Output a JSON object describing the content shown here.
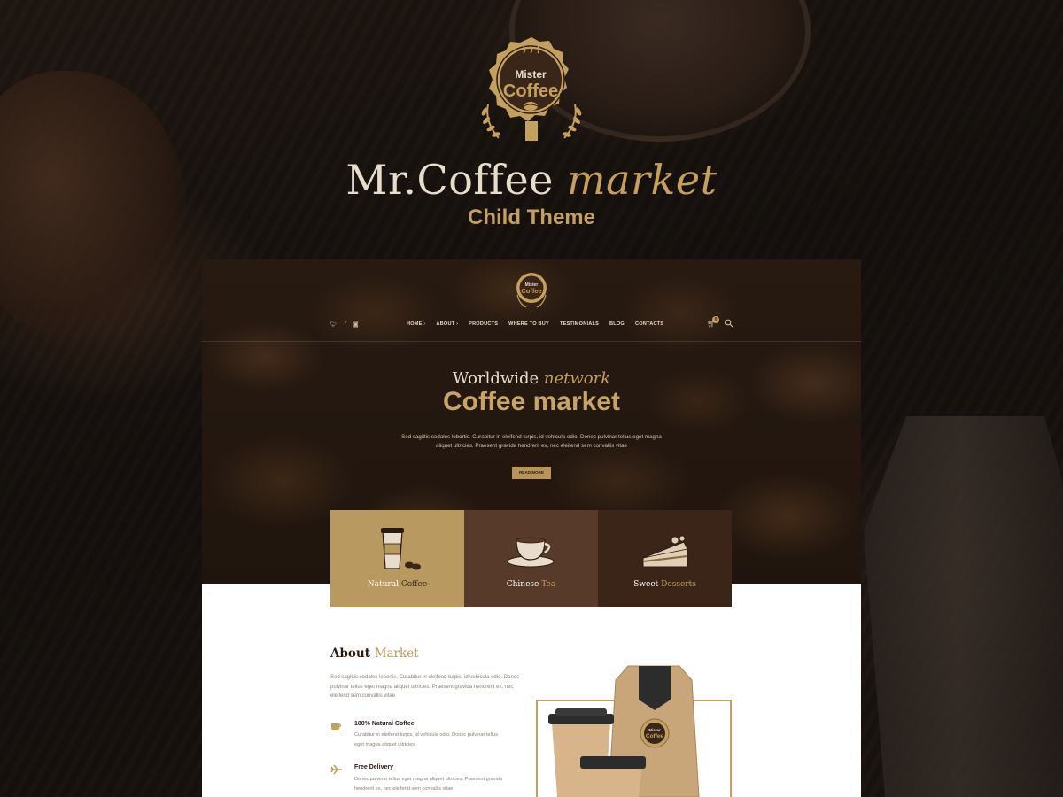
{
  "branding": {
    "logo_top": "Mister",
    "logo_main": "Coffee",
    "title_main": "Mr.Coffee",
    "title_accent": "market",
    "subtitle": "Child Theme"
  },
  "site": {
    "logo_top": "Mister",
    "logo_main": "Coffee",
    "social": [
      "twitter-icon",
      "facebook-icon",
      "instagram-icon"
    ],
    "nav": [
      {
        "label": "HOME",
        "active": true,
        "has_dropdown": true
      },
      {
        "label": "ABOUT",
        "active": false,
        "has_dropdown": true
      },
      {
        "label": "PRODUCTS",
        "active": false,
        "has_dropdown": false
      },
      {
        "label": "WHERE TO BUY",
        "active": false,
        "has_dropdown": false
      },
      {
        "label": "TESTIMONIALS",
        "active": false,
        "has_dropdown": false
      },
      {
        "label": "BLOG",
        "active": false,
        "has_dropdown": false
      },
      {
        "label": "CONTACTS",
        "active": false,
        "has_dropdown": false
      }
    ],
    "cart_count": "0",
    "hero": {
      "kicker_main": "Worldwide",
      "kicker_accent": "network",
      "title": "Coffee market",
      "text": "Sed sagittis sodales lobortis. Curabitur in eleifend turpis, id vehicula odio. Donec pulvinar tellus eget magna aliquet ultricies. Praesent gravida hendrerit ex, nec eleifend sem convallis vitae",
      "button": "READ MORE"
    },
    "tiles": [
      {
        "a": "Natural",
        "b": "Coffee",
        "icon": "coffee-cup-icon"
      },
      {
        "a": "Chinese",
        "b": "Tea",
        "icon": "tea-cup-icon"
      },
      {
        "a": "Sweet",
        "b": "Desserts",
        "icon": "cake-icon"
      }
    ],
    "about": {
      "title_a": "About",
      "title_b": "Market",
      "text": "Sed sagittis sodales lobortis. Curabitur in eleifend turpis, id vehicula odio. Donec pulvinar tellus eget magna aliquet ultricies. Praesent gravida hendrerit ex, nec eleifend sem convallis vitae",
      "features": [
        {
          "title": "100% Natural Coffee",
          "text": "Curabitur in eleifend turpis, id vehicula odio. Donec pulvinar tellus eget magna aliquet ultricies.",
          "icon": "cup-icon"
        },
        {
          "title": "Free Delivery",
          "text": "Donec pulvinar tellus eget magna aliquet ultricies. Praesent gravida hendrerit ex, nec eleifend sem convallis vitae",
          "icon": "plane-icon"
        }
      ],
      "product_logo_top": "Mister",
      "product_logo_main": "Coffee"
    }
  },
  "colors": {
    "gold": "#c4a05e",
    "dark_brown": "#2a1b12",
    "tile_gold": "#b8995f",
    "tile_brown": "#573a29",
    "tile_dark": "#3b2519"
  }
}
